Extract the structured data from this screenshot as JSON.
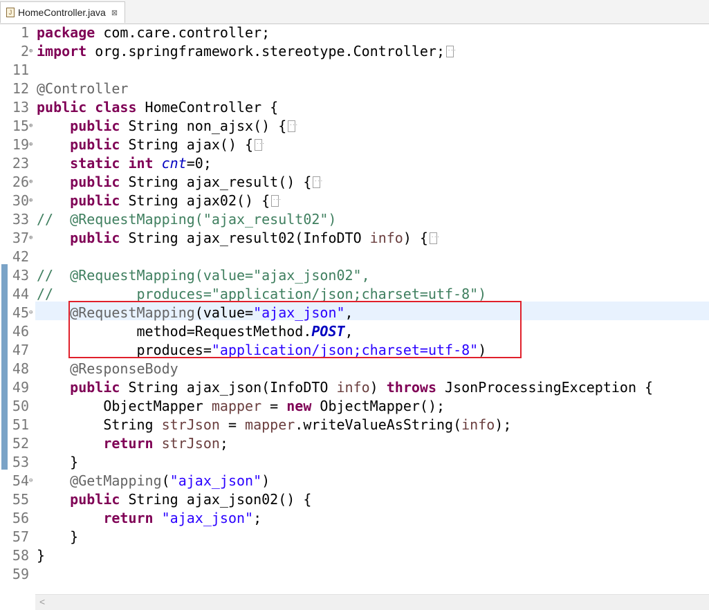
{
  "tab": {
    "title": "HomeController.java",
    "close": "⊠"
  },
  "scrollbar": {
    "left_arrow": "<"
  },
  "lines": [
    {
      "n": "1",
      "fold": "",
      "html": "<span class=\"kw\">package</span> com.care.controller;"
    },
    {
      "n": "2",
      "fold": "⊕",
      "html": "<span class=\"kw\">import</span> org.springframework.stereotype.Controller;<span class=\"fb\"></span>"
    },
    {
      "n": "11",
      "fold": "",
      "html": ""
    },
    {
      "n": "12",
      "fold": "",
      "html": "<span class=\"ann\">@Controller</span>"
    },
    {
      "n": "13",
      "fold": "",
      "html": "<span class=\"kw\">public</span> <span class=\"kw\">class</span> HomeController {"
    },
    {
      "n": "15",
      "fold": "⊕",
      "html": "    <span class=\"kw\">public</span> String non_ajsx() {<span class=\"fb\"></span>"
    },
    {
      "n": "19",
      "fold": "⊕",
      "html": "    <span class=\"kw\">public</span> String ajax() {<span class=\"fb\"></span>"
    },
    {
      "n": "23",
      "fold": "",
      "html": "    <span class=\"kw\">static</span> <span class=\"kw\">int</span> <span class=\"fld\">cnt</span>=0;"
    },
    {
      "n": "26",
      "fold": "⊕",
      "html": "    <span class=\"kw\">public</span> String ajax_result() {<span class=\"fb\"></span>"
    },
    {
      "n": "30",
      "fold": "⊕",
      "html": "    <span class=\"kw\">public</span> String ajax02() {<span class=\"fb\"></span>"
    },
    {
      "n": "33",
      "fold": "",
      "html": "<span class=\"cmt\">//  @RequestMapping(\"ajax_result02\")</span>"
    },
    {
      "n": "37",
      "fold": "⊕",
      "html": "    <span class=\"kw\">public</span> String ajax_result02(InfoDTO <span class=\"var\">info</span>) {<span class=\"fb\"></span>"
    },
    {
      "n": "42",
      "fold": "",
      "html": ""
    },
    {
      "n": "43",
      "fold": "",
      "html": "<span class=\"cmt\">//  @RequestMapping(value=\"ajax_json02\",</span>"
    },
    {
      "n": "44",
      "fold": "",
      "html": "<span class=\"cmt\">//          produces=\"application/json;charset=utf-8\")</span>"
    },
    {
      "n": "45",
      "fold": "⊖",
      "html": "    <span class=\"ann\">@RequestMapping</span>(value=<span class=\"str\">\"ajax_json\"</span>,"
    },
    {
      "n": "46",
      "fold": "",
      "html": "            method=RequestMethod.<span class=\"fldb\">POST</span>,"
    },
    {
      "n": "47",
      "fold": "",
      "html": "            produces=<span class=\"str\">\"application/json;charset=utf-8\"</span>)"
    },
    {
      "n": "48",
      "fold": "",
      "html": "    <span class=\"ann\">@ResponseBody</span>"
    },
    {
      "n": "49",
      "fold": "",
      "html": "    <span class=\"kw\">public</span> String ajax_json(InfoDTO <span class=\"var\">info</span>) <span class=\"kw\">throws</span> JsonProcessingException {"
    },
    {
      "n": "50",
      "fold": "",
      "html": "        ObjectMapper <span class=\"var\">mapper</span> = <span class=\"kw\">new</span> ObjectMapper();"
    },
    {
      "n": "51",
      "fold": "",
      "html": "        String <span class=\"var\">strJson</span> = <span class=\"var\">mapper</span>.writeValueAsString(<span class=\"var\">info</span>);"
    },
    {
      "n": "52",
      "fold": "",
      "html": "        <span class=\"kw\">return</span> <span class=\"var\">strJson</span>;"
    },
    {
      "n": "53",
      "fold": "",
      "html": "    }"
    },
    {
      "n": "54",
      "fold": "⊖",
      "html": "    <span class=\"ann\">@GetMapping</span>(<span class=\"str\">\"ajax_json\"</span>)"
    },
    {
      "n": "55",
      "fold": "",
      "html": "    <span class=\"kw\">public</span> String ajax_json02() {"
    },
    {
      "n": "56",
      "fold": "",
      "html": "        <span class=\"kw\">return</span> <span class=\"str\">\"ajax_json\"</span>;"
    },
    {
      "n": "57",
      "fold": "",
      "html": "    }"
    },
    {
      "n": "58",
      "fold": "",
      "html": "}"
    },
    {
      "n": "59",
      "fold": "",
      "html": ""
    }
  ]
}
